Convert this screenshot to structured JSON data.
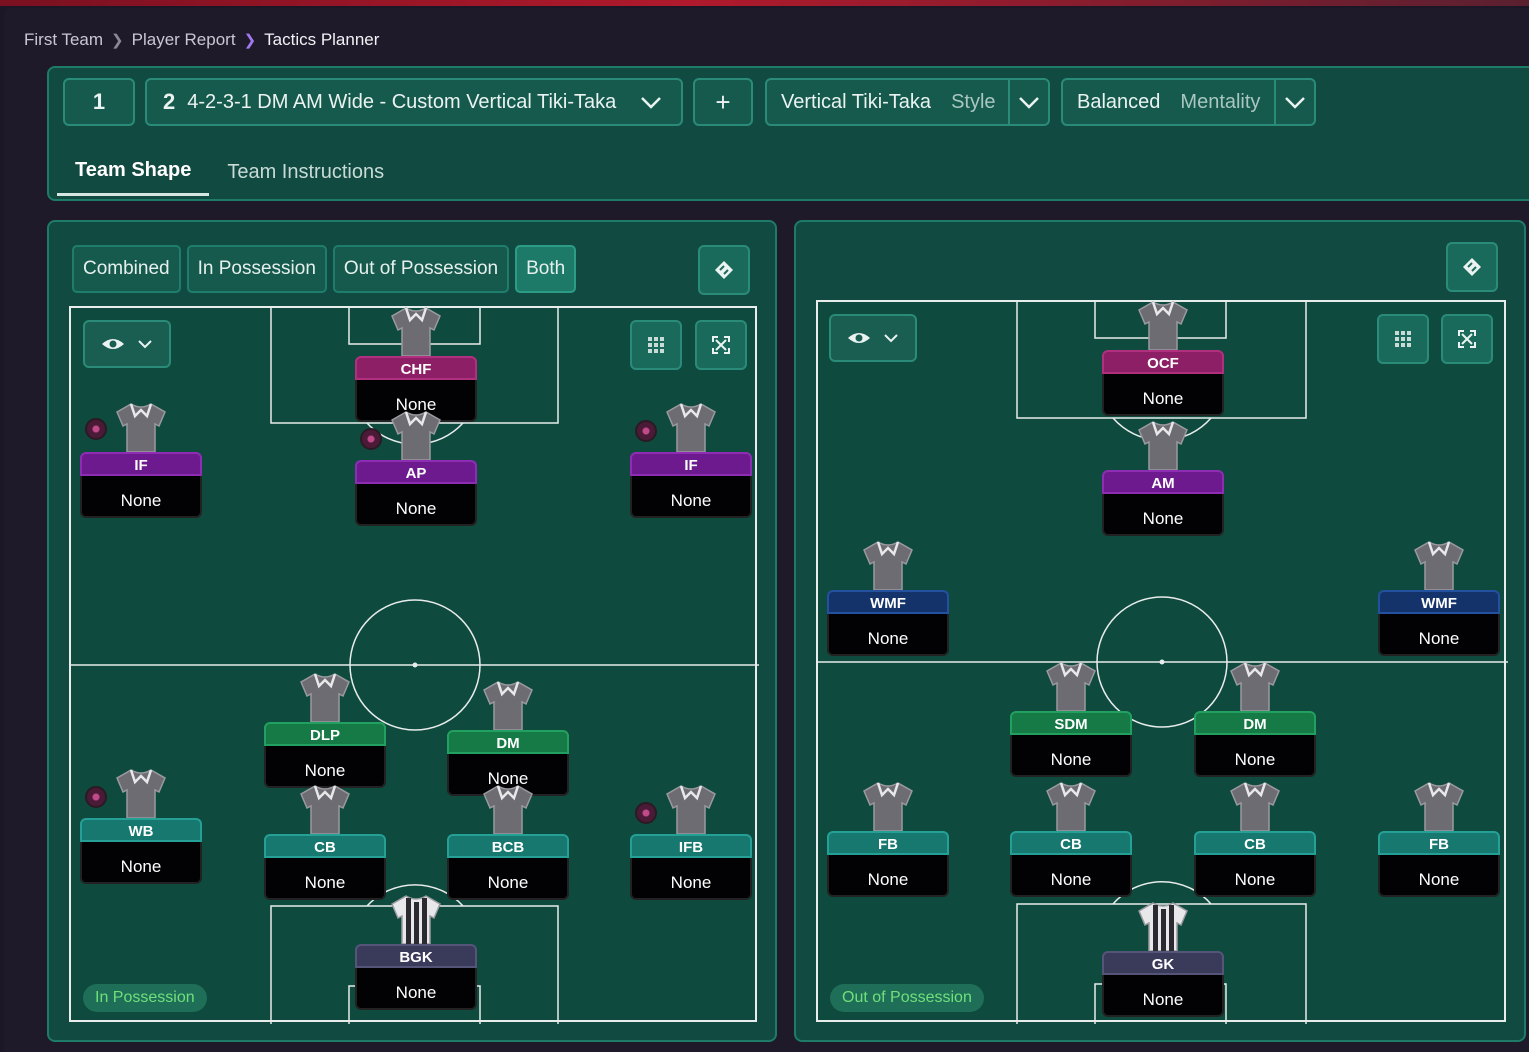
{
  "breadcrumb": {
    "items": [
      "First Team",
      "Player Report",
      "Tactics Planner"
    ]
  },
  "header": {
    "tactic_slot_1": "1",
    "tactic_slot_2_num": "2",
    "tactic_name": "4-2-3-1 DM AM Wide - Custom Vertical Tiki-Taka",
    "add_label": "+",
    "style_value": "Vertical Tiki-Taka",
    "style_label": "Style",
    "mentality_value": "Balanced",
    "mentality_label": "Mentality"
  },
  "tabs": [
    "Team Shape",
    "Team Instructions"
  ],
  "filters": [
    "Combined",
    "In Possession",
    "Out of Possession",
    "Both"
  ],
  "left_pitch": {
    "badge": "In Possession",
    "players": [
      {
        "role": "CHF",
        "name": "None"
      },
      {
        "role": "IF",
        "name": "None"
      },
      {
        "role": "AP",
        "name": "None"
      },
      {
        "role": "IF",
        "name": "None"
      },
      {
        "role": "DLP",
        "name": "None"
      },
      {
        "role": "DM",
        "name": "None"
      },
      {
        "role": "WB",
        "name": "None"
      },
      {
        "role": "CB",
        "name": "None"
      },
      {
        "role": "BCB",
        "name": "None"
      },
      {
        "role": "IFB",
        "name": "None"
      },
      {
        "role": "BGK",
        "name": "None"
      }
    ]
  },
  "right_pitch": {
    "badge": "Out of Possession",
    "players": [
      {
        "role": "OCF",
        "name": "None"
      },
      {
        "role": "AM",
        "name": "None"
      },
      {
        "role": "WMF",
        "name": "None"
      },
      {
        "role": "WMF",
        "name": "None"
      },
      {
        "role": "SDM",
        "name": "None"
      },
      {
        "role": "DM",
        "name": "None"
      },
      {
        "role": "FB",
        "name": "None"
      },
      {
        "role": "CB",
        "name": "None"
      },
      {
        "role": "CB",
        "name": "None"
      },
      {
        "role": "FB",
        "name": "None"
      },
      {
        "role": "GK",
        "name": "None"
      }
    ]
  },
  "colors": {
    "panel": "#114a40",
    "attack_role": "#8c1f66",
    "midfield_role": "#6d1a8f",
    "defensive_mid_role": "#157a45",
    "defence_role": "#16786e",
    "wide_role": "#15336b",
    "goalkeeper_role": "#3a3a5a",
    "phase_badge_text": "#6fe07a"
  },
  "icons": [
    "chevron-right-icon",
    "chevron-down-icon",
    "plus-icon",
    "tactics-board-icon",
    "eye-icon",
    "grid-icon",
    "expand-icon",
    "shirt-icon",
    "instruction-dot-icon"
  ]
}
